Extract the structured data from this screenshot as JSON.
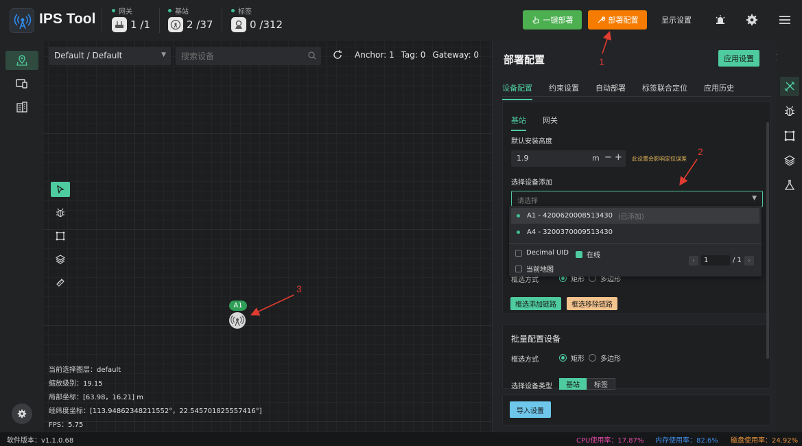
{
  "app": {
    "title": "IPS Tool",
    "version_label": "软件版本：v1.1.0.68"
  },
  "header": {
    "stats": [
      {
        "label": "网关",
        "value": "1 /1",
        "icon": "gateway-icon"
      },
      {
        "label": "基站",
        "value": "2 /37",
        "icon": "anchor-icon"
      },
      {
        "label": "标签",
        "value": "0 /312",
        "icon": "tag-icon"
      }
    ],
    "one_click_deploy": "一键部署",
    "deploy_config": "部署配置",
    "display_settings": "显示设置"
  },
  "map": {
    "selected_map": "Default / Default",
    "search_placeholder": "搜索设备",
    "counts": {
      "anchor": "Anchor: 1",
      "tag": "Tag: 0",
      "gateway": "Gateway: 0"
    },
    "marker_label": "A1",
    "info": {
      "layer_k": "当前选择图层：",
      "layer_v": "default",
      "zoom_k": "缩放级别：",
      "zoom_v": "19.15",
      "local_k": "局部坐标：",
      "local_v": "[63.98，16.21] m",
      "lnglat_k": "经纬度坐标：",
      "lnglat_v": "[113.94862348211552°，22.545701825557416°]",
      "fps_k": "FPS：",
      "fps_v": "5.75"
    }
  },
  "status": {
    "cpu": "CPU使用率：17.87%",
    "mem": "内存使用率：82.6%",
    "disk": "磁盘使用率：24.92%"
  },
  "panel": {
    "title": "部署配置",
    "apply": "应用设置",
    "tabs": [
      "设备配置",
      "约束设置",
      "自动部署",
      "标签联合定位",
      "应用历史"
    ],
    "subtabs": [
      "基站",
      "网关"
    ],
    "default_height_label": "默认安装高度",
    "default_height_value": "1.9",
    "height_unit": "m",
    "height_warning": "此设置会影响定位误差",
    "select_device_label": "选择设备添加",
    "select_placeholder": "请选择",
    "dropdown": {
      "items": [
        {
          "text": "A1 - 4200620008513430",
          "added": "(已添加)"
        },
        {
          "text": "A4 - 3200370009513430",
          "added": ""
        }
      ],
      "decimal_uid": "Decimal UID",
      "online": "在线",
      "current_map": "当前地图",
      "page": "1",
      "total": "/ 1"
    },
    "frame_mode_label": "框选方式",
    "rect": "矩形",
    "polygon": "多边形",
    "add_link": "框选添加链路",
    "remove_link": "框选移除链路",
    "batch_title": "批量配置设备",
    "batch_frame_label": "框选方式",
    "batch_rect": "矩形",
    "batch_polygon": "多边形",
    "batch_type_label": "选择设备类型",
    "type_anchor": "基站",
    "type_tag": "标签",
    "import": "导入设置"
  },
  "annotations": [
    "1",
    "2",
    "3"
  ],
  "colors": {
    "accent": "#4ecb9f",
    "green_button": "#4caf50",
    "orange_button": "#f57c00",
    "annotation": "#e03c31"
  }
}
